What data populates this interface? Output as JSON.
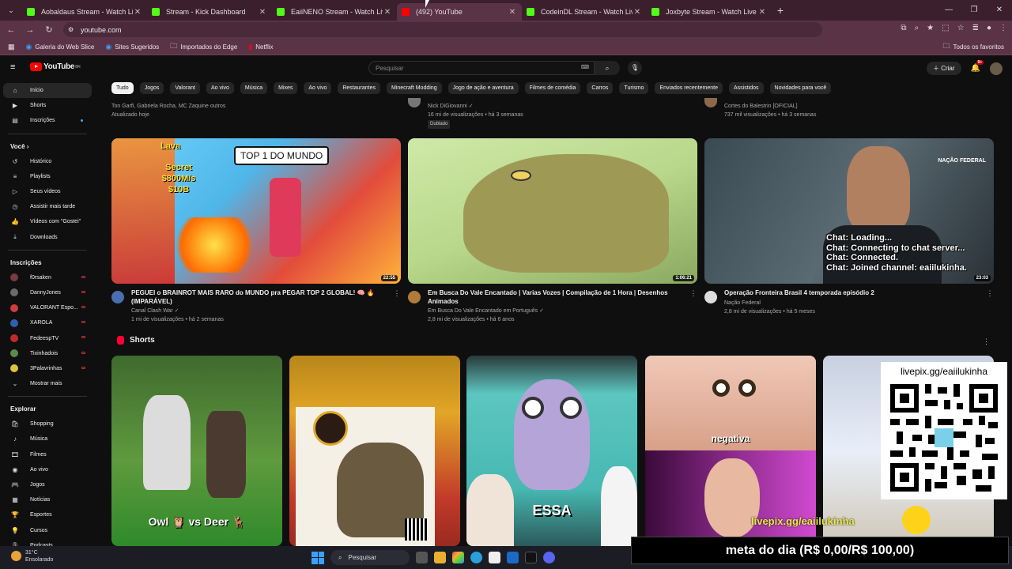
{
  "browser": {
    "tabs": [
      {
        "title": "Aobaldaus Stream - Watch Live",
        "favicon_color": "#53fc18",
        "active": false
      },
      {
        "title": "Stream - Kick Dashboard",
        "favicon_color": "#53fc18",
        "active": false
      },
      {
        "title": "EaiiNENO Stream - Watch Live",
        "favicon_color": "#53fc18",
        "active": false
      },
      {
        "title": "(492) YouTube",
        "favicon_color": "#ff0000",
        "active": true
      },
      {
        "title": "CodeinDL Stream - Watch Live",
        "favicon_color": "#53fc18",
        "active": false
      },
      {
        "title": "Joxbyte Stream - Watch Live on",
        "favicon_color": "#53fc18",
        "active": false
      }
    ],
    "url": "youtube.com",
    "bookmarks": [
      "Galeria do Web Slice",
      "Sites Sugeridos",
      "Importados do Edge",
      "Netflix"
    ],
    "favorites": "Todos os favoritos"
  },
  "youtube": {
    "logo": "YouTube",
    "logo_country": "BR",
    "search_placeholder": "Pesquisar",
    "create_label": "Criar",
    "notif_count": "9+",
    "chips": [
      "Tudo",
      "Jogos",
      "Valorant",
      "Ao vivo",
      "Música",
      "Mixes",
      "Ao vivo",
      "Restaurantes",
      "Minecraft Modding",
      "Jogo de ação e aventura",
      "Filmes de comédia",
      "Carros",
      "Turismo",
      "Enviados recentemente",
      "Assistidos",
      "Novidades para você"
    ]
  },
  "sidebar": {
    "main": [
      {
        "label": "Início",
        "icon": "home-icon",
        "glyph": "⌂"
      },
      {
        "label": "Shorts",
        "icon": "shorts-icon",
        "glyph": "▶"
      },
      {
        "label": "Inscrições",
        "icon": "subscriptions-icon",
        "glyph": "▤"
      }
    ],
    "you_header": "Você",
    "you": [
      {
        "label": "Histórico",
        "icon": "history-icon",
        "glyph": "↺"
      },
      {
        "label": "Playlists",
        "icon": "playlists-icon",
        "glyph": "≡"
      },
      {
        "label": "Seus vídeos",
        "icon": "your-videos-icon",
        "glyph": "▷"
      },
      {
        "label": "Assistir mais tarde",
        "icon": "watch-later-icon",
        "glyph": "◷"
      },
      {
        "label": "Vídeos com \"Gostei\"",
        "icon": "liked-icon",
        "glyph": "👍"
      },
      {
        "label": "Downloads",
        "icon": "downloads-icon",
        "glyph": "⤓"
      }
    ],
    "subs_header": "Inscrições",
    "subs": [
      {
        "label": "f0rsaken",
        "color": "#7a3b3b"
      },
      {
        "label": "DannyJones",
        "color": "#6b6b6b"
      },
      {
        "label": "VALORANT Espo...",
        "color": "#d13c3c"
      },
      {
        "label": "XAROLA",
        "color": "#2f5fb0"
      },
      {
        "label": "FedeespTV",
        "color": "#c22a2a"
      },
      {
        "label": "Tixinhadois",
        "color": "#5b8b4b"
      },
      {
        "label": "3Palavrinhas",
        "color": "#e2c23a"
      }
    ],
    "show_more": "Mostrar mais",
    "explore_header": "Explorar",
    "explore": [
      {
        "label": "Shopping",
        "icon": "shopping-icon",
        "glyph": "🛍"
      },
      {
        "label": "Música",
        "icon": "music-icon",
        "glyph": "♪"
      },
      {
        "label": "Filmes",
        "icon": "movies-icon",
        "glyph": "🎞"
      },
      {
        "label": "Ao vivo",
        "icon": "live-icon",
        "glyph": "◉"
      },
      {
        "label": "Jogos",
        "icon": "gaming-icon",
        "glyph": "🎮"
      },
      {
        "label": "Notícias",
        "icon": "news-icon",
        "glyph": "▦"
      },
      {
        "label": "Esportes",
        "icon": "sports-icon",
        "glyph": "🏆"
      },
      {
        "label": "Cursos",
        "icon": "courses-icon",
        "glyph": "💡"
      },
      {
        "label": "Podcasts",
        "icon": "podcasts-icon",
        "glyph": "🎙"
      }
    ]
  },
  "previous_row": [
    {
      "line1": "Ton Garfi, Gabriela Rocha, MC Zaquine outros",
      "line2": "Atualizado hoje",
      "badge": ""
    },
    {
      "line1": "Nick DiGiovanni ✓",
      "line2": "16 mi de visualizações • há 3 semanas",
      "badge": "Dublado"
    },
    {
      "line1": "Cortes do Balestrin [OFICIAL]",
      "line2": "737 mil visualizações • há 3 semanas",
      "badge": ""
    }
  ],
  "videos": [
    {
      "title": "PEGUEI o BRAINROT MAIS RARO do MUNDO pra PEGAR TOP 2 GLOBAL! 🧠 🔥 (IMPARÁVEL)",
      "channel": "Canal Clash War ✓",
      "meta": "1 mi de visualizações • há 2 semanas",
      "duration": "22:55",
      "thumb_text": "TOP 1 DO MUNDO",
      "thumb_text2": "Lava",
      "thumb_text3": "Secret $800M/s $10B",
      "avatar_color": "#4a6fb0"
    },
    {
      "title": "Em Busca Do Vale Encantado | Varias Vozes | Compilação de 1 Hora | Desenhos Animados",
      "channel": "Em Busca Do Vale Encantado em Português ✓",
      "meta": "2,8 mi de visualizações • há 6 anos",
      "duration": "1:06:21",
      "avatar_color": "#b07a3a"
    },
    {
      "title": "Operação Fronteira Brasil 4 temporada episódio 2",
      "channel": "Nação Federal",
      "meta": "2,8 mi de visualizações • há 5 meses",
      "duration": "23:03",
      "thumb_text": "NAÇÃO FEDERAL",
      "avatar_color": "#dddddd"
    }
  ],
  "shorts": {
    "title": "Shorts",
    "items": [
      {
        "caption": "Owl 🦉 vs Deer 🦌"
      },
      {
        "caption": ""
      },
      {
        "caption": "ESSA"
      },
      {
        "caption": "negativa"
      },
      {
        "caption": ""
      }
    ]
  },
  "stream_overlay": {
    "chat_lines": [
      "Chat: Loading...",
      "Chat: Connecting to chat server...",
      "Chat: Connected.",
      "Chat: Joined channel: eaiilukinha."
    ],
    "qr_label": "livepix.gg/eaiilukinha",
    "link_text": "livepix.gg/eaiilukinha",
    "goal_text": "meta do dia (R$ 0,00/R$ 100,00)"
  },
  "taskbar": {
    "weather_temp": "31°C",
    "weather_desc": "Ensolarado",
    "search_label": "Pesquisar"
  }
}
